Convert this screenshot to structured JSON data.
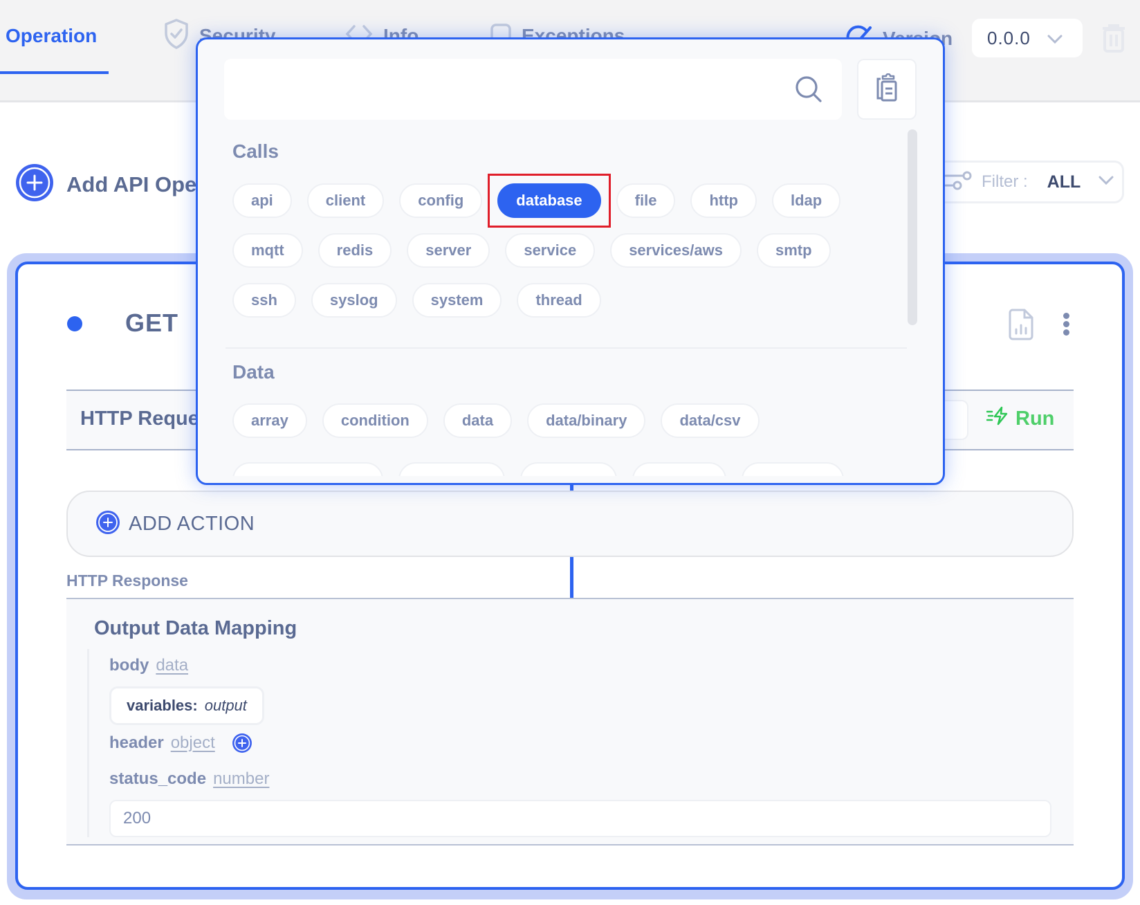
{
  "tabs": [
    {
      "label": "Operation",
      "icon": "operation",
      "active": true
    },
    {
      "label": "Security",
      "icon": "shield-check-icon",
      "active": false
    },
    {
      "label": "Info",
      "icon": "code-icon",
      "active": false
    },
    {
      "label": "Exceptions",
      "icon": "square-icon",
      "active": false
    }
  ],
  "version": {
    "label": "Version",
    "value": "0.0.0"
  },
  "add_operation": {
    "label": "Add API Operation"
  },
  "filter": {
    "label": "Filter :",
    "value": "ALL"
  },
  "operation": {
    "method": "GET",
    "path": "/",
    "request_label": "HTTP Request",
    "run_label": "Run",
    "add_action_label": "ADD ACTION",
    "response_label": "HTTP Response",
    "output_mapping": {
      "title": "Output Data Mapping",
      "body": {
        "key": "body",
        "type": "data",
        "variables_key": "variables:",
        "variables_value": "output"
      },
      "header": {
        "key": "header",
        "type": "object"
      },
      "status_code": {
        "key": "status_code",
        "type": "number",
        "value": "200"
      }
    }
  },
  "popup": {
    "search": {
      "value": "",
      "placeholder": ""
    },
    "sections": [
      {
        "title": "Calls",
        "rows": [
          [
            "api",
            "client",
            "config",
            "database",
            "file",
            "http",
            "ldap"
          ],
          [
            "mqtt",
            "redis",
            "server",
            "service",
            "services/aws",
            "smtp"
          ],
          [
            "ssh",
            "syslog",
            "system",
            "thread"
          ]
        ],
        "selected": "database"
      },
      {
        "title": "Data",
        "rows": [
          [
            "array",
            "condition",
            "data",
            "data/binary",
            "data/csv"
          ]
        ],
        "clipped_row_count": 5
      }
    ]
  },
  "colors": {
    "accent": "#2d63f0",
    "run": "#4fcf6a",
    "highlight": "#e01e2a",
    "muted_text": "#7d8bb0"
  }
}
